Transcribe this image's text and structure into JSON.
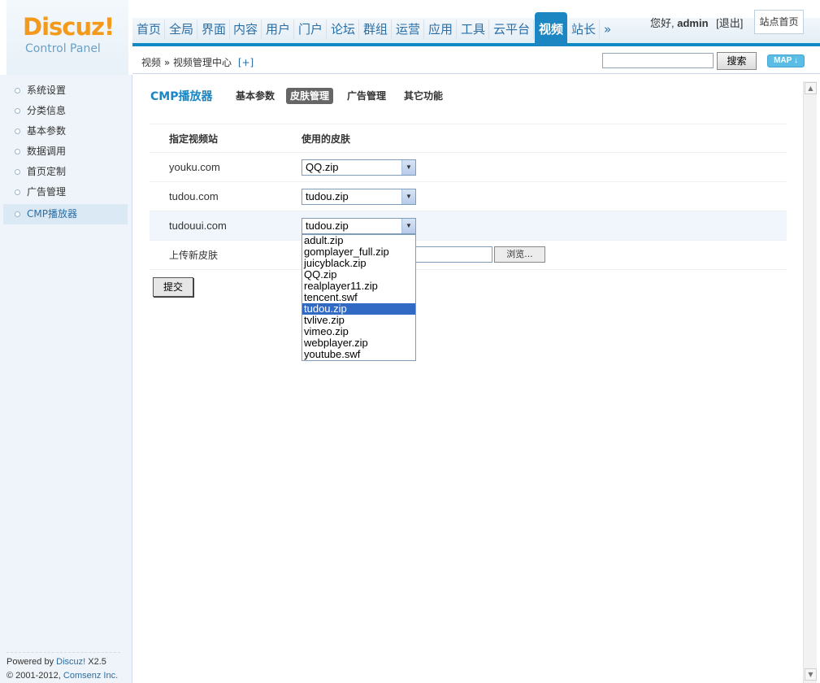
{
  "logo": {
    "brand": "Discuz!",
    "subtitle": "Control Panel"
  },
  "topnav": {
    "tabs": [
      "首页",
      "全局",
      "界面",
      "内容",
      "用户",
      "门户",
      "论坛",
      "群组",
      "运营",
      "应用",
      "工具",
      "云平台",
      "视频",
      "站长",
      "»"
    ],
    "active": "视频"
  },
  "user": {
    "greeting": "您好,",
    "name": "admin",
    "logout": "[退出]",
    "site_home": "站点首页"
  },
  "subbar": {
    "breadcrumb": "视频 » 视频管理中心",
    "add": "[+]",
    "search_value": "",
    "search_button": "搜索",
    "map_button": "MAP ↓"
  },
  "sidebar": {
    "items": [
      {
        "label": "系统设置"
      },
      {
        "label": "分类信息"
      },
      {
        "label": "基本参数"
      },
      {
        "label": "数据调用"
      },
      {
        "label": "首页定制"
      },
      {
        "label": "广告管理"
      },
      {
        "label": "CMP播放器"
      }
    ],
    "active": "CMP播放器"
  },
  "copyright": {
    "line1_prefix": "Powered by",
    "line1_link": "Discuz!",
    "line1_version": "X2.5",
    "line2_prefix": "© 2001-2012,",
    "line2_link": "Comsenz Inc."
  },
  "main": {
    "title": "CMP播放器",
    "tabs": [
      "基本参数",
      "皮肤管理",
      "广告管理",
      "其它功能"
    ],
    "active_tab": "皮肤管理",
    "table_headers": [
      "指定视频站",
      "使用的皮肤"
    ],
    "rows": [
      {
        "site": "youku.com",
        "skin": "QQ.zip"
      },
      {
        "site": "tudou.com",
        "skin": "tudou.zip"
      },
      {
        "site": "tudouui.com",
        "skin": "tudou.zip"
      }
    ],
    "upload_label": "上传新皮肤",
    "browse_button": "浏览...",
    "submit_button": "提交"
  },
  "dropdown": {
    "options": [
      "adult.zip",
      "gomplayer_full.zip",
      "juicyblack.zip",
      "QQ.zip",
      "realplayer11.zip",
      "tencent.swf",
      "tudou.zip",
      "tvlive.zip",
      "vimeo.zip",
      "webplayer.zip",
      "youtube.swf"
    ],
    "selected": "tudou.zip"
  },
  "colors": {
    "accent": "#1b86c2",
    "brand": "#f39a1d",
    "selection": "#316ac5"
  }
}
